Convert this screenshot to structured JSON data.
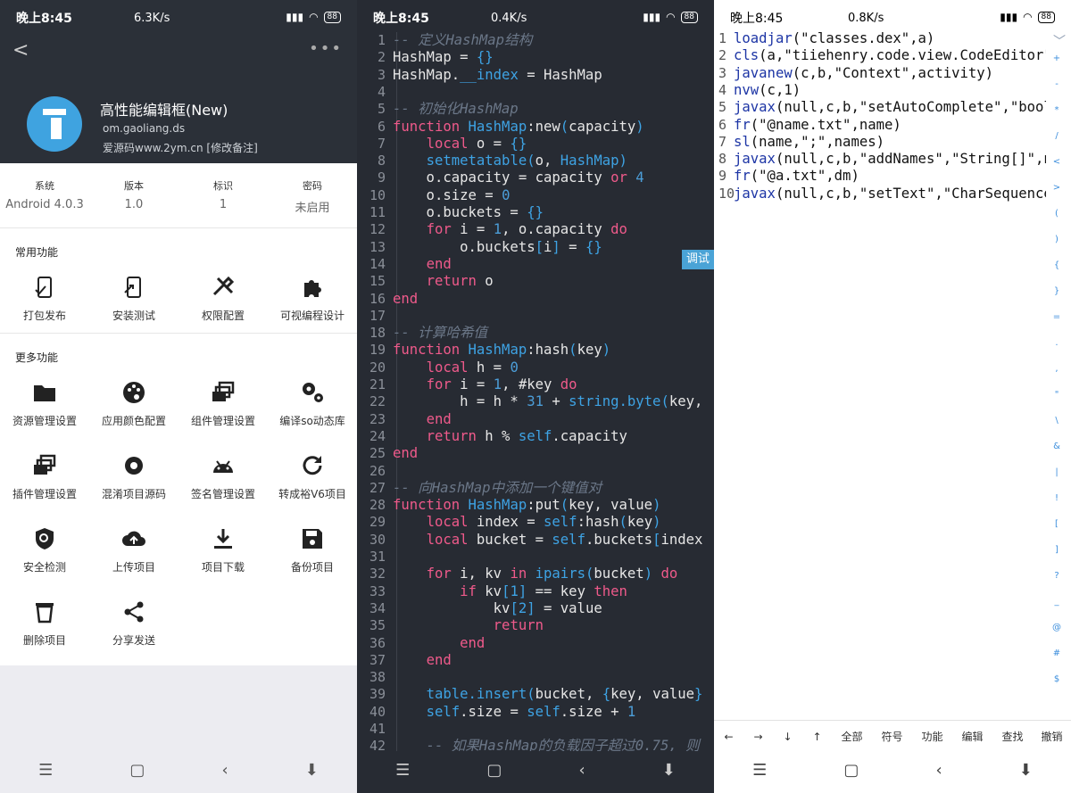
{
  "panel1": {
    "status": {
      "time": "晚上8:45",
      "net": "6.3K/s",
      "battery": "88"
    },
    "app": {
      "title": "高性能编辑框(New)",
      "package": "om.gaoliang.ds",
      "note": "爱源码www.2ym.cn [修改备注]"
    },
    "info": [
      {
        "key": "系统",
        "value": "Android 4.0.3"
      },
      {
        "key": "版本",
        "value": "1.0"
      },
      {
        "key": "标识",
        "value": "1"
      },
      {
        "key": "密码",
        "value": "未启用"
      }
    ],
    "common_title": "常用功能",
    "common": [
      {
        "label": "打包发布",
        "icon": "package-phone-icon"
      },
      {
        "label": "安装测试",
        "icon": "install-phone-icon"
      },
      {
        "label": "权限配置",
        "icon": "tools-icon"
      },
      {
        "label": "可视编程设计",
        "icon": "puzzle-icon"
      }
    ],
    "more_title": "更多功能",
    "more": [
      {
        "label": "资源管理设置",
        "icon": "folder-icon"
      },
      {
        "label": "应用颜色配置",
        "icon": "palette-icon"
      },
      {
        "label": "组件管理设置",
        "icon": "layers-icon"
      },
      {
        "label": "编译so动态库",
        "icon": "gears-icon"
      },
      {
        "label": "插件管理设置",
        "icon": "layers-icon"
      },
      {
        "label": "混淆项目源码",
        "icon": "gear-icon"
      },
      {
        "label": "签名管理设置",
        "icon": "android-icon"
      },
      {
        "label": "转成裕V6项目",
        "icon": "refresh-icon"
      },
      {
        "label": "安全检测",
        "icon": "shield-icon"
      },
      {
        "label": "上传项目",
        "icon": "cloud-upload-icon"
      },
      {
        "label": "项目下载",
        "icon": "download-icon"
      },
      {
        "label": "备份项目",
        "icon": "save-icon"
      },
      {
        "label": "删除项目",
        "icon": "trash-icon"
      },
      {
        "label": "分享发送",
        "icon": "share-icon"
      }
    ]
  },
  "panel2": {
    "status": {
      "time": "晚上8:45",
      "net": "0.4K/s",
      "battery": "88"
    },
    "debug_label": "调试",
    "lines": [
      [
        [
          "cm",
          "-- 定义HashMap结构"
        ]
      ],
      [
        [
          "txt",
          "HashMap = "
        ],
        [
          "fn",
          "{}"
        ]
      ],
      [
        [
          "txt",
          "HashMap."
        ],
        [
          "fn",
          "__index"
        ],
        [
          "txt",
          " = HashMap"
        ]
      ],
      [
        [
          "txt",
          ""
        ]
      ],
      [
        [
          "cm",
          "-- 初始化HashMap"
        ]
      ],
      [
        [
          "kw",
          "function "
        ],
        [
          "fn",
          "HashMap"
        ],
        [
          "txt",
          ":new"
        ],
        [
          "fn",
          "("
        ],
        [
          "txt",
          "capacity"
        ],
        [
          "fn",
          ")"
        ]
      ],
      [
        [
          "txt",
          "    "
        ],
        [
          "kw",
          "local "
        ],
        [
          "txt",
          "o = "
        ],
        [
          "fn",
          "{}"
        ]
      ],
      [
        [
          "txt",
          "    "
        ],
        [
          "fn",
          "setmetatable("
        ],
        [
          "txt",
          "o, "
        ],
        [
          "fn",
          "HashMap)"
        ]
      ],
      [
        [
          "txt",
          "    o.capacity = capacity "
        ],
        [
          "kw",
          "or "
        ],
        [
          "num",
          "4"
        ]
      ],
      [
        [
          "txt",
          "    o.size = "
        ],
        [
          "num",
          "0"
        ]
      ],
      [
        [
          "txt",
          "    o.buckets = "
        ],
        [
          "fn",
          "{}"
        ]
      ],
      [
        [
          "txt",
          "    "
        ],
        [
          "kw",
          "for "
        ],
        [
          "txt",
          "i = "
        ],
        [
          "num",
          "1"
        ],
        [
          "txt",
          ", o.capacity "
        ],
        [
          "kw",
          "do"
        ]
      ],
      [
        [
          "txt",
          "        o.buckets"
        ],
        [
          "fn",
          "["
        ],
        [
          "txt",
          "i"
        ],
        [
          "fn",
          "]"
        ],
        [
          "txt",
          " = "
        ],
        [
          "fn",
          "{}"
        ]
      ],
      [
        [
          "txt",
          "    "
        ],
        [
          "kw",
          "end"
        ]
      ],
      [
        [
          "txt",
          "    "
        ],
        [
          "kw",
          "return "
        ],
        [
          "txt",
          "o"
        ]
      ],
      [
        [
          "kw",
          "end"
        ]
      ],
      [
        [
          "txt",
          ""
        ]
      ],
      [
        [
          "cm",
          "-- 计算哈希值"
        ]
      ],
      [
        [
          "kw",
          "function "
        ],
        [
          "fn",
          "HashMap"
        ],
        [
          "txt",
          ":hash"
        ],
        [
          "fn",
          "("
        ],
        [
          "txt",
          "key"
        ],
        [
          "fn",
          ")"
        ]
      ],
      [
        [
          "txt",
          "    "
        ],
        [
          "kw",
          "local "
        ],
        [
          "txt",
          "h = "
        ],
        [
          "num",
          "0"
        ]
      ],
      [
        [
          "txt",
          "    "
        ],
        [
          "kw",
          "for "
        ],
        [
          "txt",
          "i = "
        ],
        [
          "num",
          "1"
        ],
        [
          "txt",
          ", #key "
        ],
        [
          "kw",
          "do"
        ]
      ],
      [
        [
          "txt",
          "        h = h * "
        ],
        [
          "num",
          "31"
        ],
        [
          "txt",
          " + "
        ],
        [
          "fn",
          "string.byte("
        ],
        [
          "txt",
          "key,"
        ]
      ],
      [
        [
          "txt",
          "    "
        ],
        [
          "kw",
          "end"
        ]
      ],
      [
        [
          "txt",
          "    "
        ],
        [
          "kw",
          "return "
        ],
        [
          "txt",
          "h % "
        ],
        [
          "fn",
          "self"
        ],
        [
          "txt",
          ".capacity"
        ]
      ],
      [
        [
          "kw",
          "end"
        ]
      ],
      [
        [
          "txt",
          ""
        ]
      ],
      [
        [
          "cm",
          "-- 向HashMap中添加一个键值对"
        ]
      ],
      [
        [
          "kw",
          "function "
        ],
        [
          "fn",
          "HashMap"
        ],
        [
          "txt",
          ":put"
        ],
        [
          "fn",
          "("
        ],
        [
          "txt",
          "key, value"
        ],
        [
          "fn",
          ")"
        ]
      ],
      [
        [
          "txt",
          "    "
        ],
        [
          "kw",
          "local "
        ],
        [
          "txt",
          "index = "
        ],
        [
          "fn",
          "self"
        ],
        [
          "txt",
          ":hash"
        ],
        [
          "fn",
          "("
        ],
        [
          "txt",
          "key"
        ],
        [
          "fn",
          ")"
        ]
      ],
      [
        [
          "txt",
          "    "
        ],
        [
          "kw",
          "local "
        ],
        [
          "txt",
          "bucket = "
        ],
        [
          "fn",
          "self"
        ],
        [
          "txt",
          ".buckets"
        ],
        [
          "fn",
          "["
        ],
        [
          "txt",
          "index"
        ]
      ],
      [
        [
          "txt",
          ""
        ]
      ],
      [
        [
          "txt",
          "    "
        ],
        [
          "kw",
          "for "
        ],
        [
          "txt",
          "i, kv "
        ],
        [
          "kw",
          "in "
        ],
        [
          "fn",
          "ipairs("
        ],
        [
          "txt",
          "bucket"
        ],
        [
          "fn",
          ")"
        ],
        [
          "kw",
          " do"
        ]
      ],
      [
        [
          "txt",
          "        "
        ],
        [
          "kw",
          "if "
        ],
        [
          "txt",
          "kv"
        ],
        [
          "fn",
          "[1]"
        ],
        [
          "txt",
          " == key "
        ],
        [
          "kw",
          "then"
        ]
      ],
      [
        [
          "txt",
          "            kv"
        ],
        [
          "fn",
          "[2]"
        ],
        [
          "txt",
          " = value"
        ]
      ],
      [
        [
          "txt",
          "            "
        ],
        [
          "kw",
          "return"
        ]
      ],
      [
        [
          "txt",
          "        "
        ],
        [
          "kw",
          "end"
        ]
      ],
      [
        [
          "txt",
          "    "
        ],
        [
          "kw",
          "end"
        ]
      ],
      [
        [
          "txt",
          ""
        ]
      ],
      [
        [
          "txt",
          "    "
        ],
        [
          "fn",
          "table.insert("
        ],
        [
          "txt",
          "bucket, "
        ],
        [
          "fn",
          "{"
        ],
        [
          "txt",
          "key, value"
        ],
        [
          "fn",
          "}"
        ]
      ],
      [
        [
          "txt",
          "    "
        ],
        [
          "fn",
          "self"
        ],
        [
          "txt",
          ".size = "
        ],
        [
          "fn",
          "self"
        ],
        [
          "txt",
          ".size + "
        ],
        [
          "num",
          "1"
        ]
      ],
      [
        [
          "txt",
          ""
        ]
      ],
      [
        [
          "cm",
          "    -- 如果HashMap的负载因子超过0.75, 则"
        ]
      ]
    ]
  },
  "panel3": {
    "status": {
      "time": "晚上8:45",
      "net": "0.8K/s",
      "battery": "88"
    },
    "lines": [
      [
        [
          "fn3",
          "loadjar"
        ],
        [
          "t",
          "(\"classes.dex\",a)"
        ]
      ],
      [
        [
          "fn3",
          "cls"
        ],
        [
          "t",
          "(a,\"tiiehenry.code.view.CodeEditor\""
        ]
      ],
      [
        [
          "fn3",
          "javanew"
        ],
        [
          "t",
          "(c,b,\"Context\",activity)"
        ]
      ],
      [
        [
          "fn3",
          "nvw"
        ],
        [
          "t",
          "(c,1)"
        ]
      ],
      [
        [
          "fn3",
          "javax"
        ],
        [
          "t",
          "(null,c,b,\"setAutoComplete\",\"bool"
        ]
      ],
      [
        [
          "fn3",
          "fr"
        ],
        [
          "t",
          "(\"@name.txt\",name)"
        ]
      ],
      [
        [
          "fn3",
          "sl"
        ],
        [
          "t",
          "(name,\";\",names)"
        ]
      ],
      [
        [
          "fn3",
          "javax"
        ],
        [
          "t",
          "(null,c,b,\"addNames\",\"String[]\",n"
        ]
      ],
      [
        [
          "fn3",
          "fr"
        ],
        [
          "t",
          "(\"@a.txt\",dm)"
        ]
      ],
      [
        [
          "fn3",
          "javax"
        ],
        [
          "t",
          "(null,c,b,\"setText\",\"CharSequence"
        ]
      ]
    ],
    "symbols": [
      "+",
      "-",
      "*",
      "/",
      "<",
      ">",
      "(",
      ")",
      "{",
      "}",
      "=",
      ".",
      ",",
      "\"",
      "\\",
      "&",
      "|",
      "!",
      "[",
      "]",
      "?",
      "_",
      "@",
      "#",
      "$"
    ],
    "toolbar": [
      "←",
      "→",
      "↓",
      "↑",
      "全部",
      "符号",
      "功能",
      "编辑",
      "查找",
      "撤销"
    ]
  }
}
